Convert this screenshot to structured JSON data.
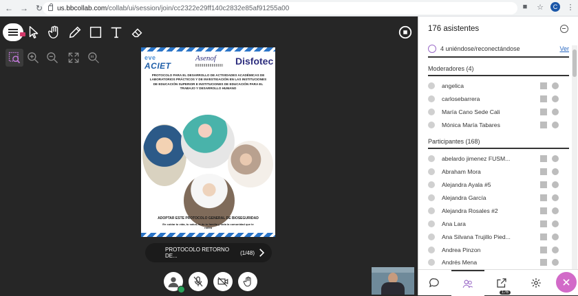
{
  "browser": {
    "url_host": "us.bbcollab.com",
    "url_path": "/collab/ui/session/join/cc2322e29ff140c2832e85af91255a00",
    "avatar_letter": "C"
  },
  "document": {
    "logo_left": "ACIET",
    "logo_left_top": "eve",
    "logo_middle": "Asenof",
    "logo_right": "Disfotec",
    "title": "PROTOCOLO PARA EL DESARROLLO DE ACTIVIDADES ACADÉMICAS DE LABORATORIOS PRÁCTICOS Y DE INVESTIGACIÓN EN LAS INSTITUCIONES DE EDUCACIÓN SUPERIOR E INSTITUCIONES DE EDUCACIÓN PARA EL TRABAJO Y DESARROLLO HUMANO",
    "footer_title": "ADOPTAR ESTE PROTOCOLO GENERAL DE BIOSEGURIDAD",
    "footer_line": "En cuidar tu vida, tu salud, la de tu familia y toda la comunidad que te rodea"
  },
  "slide_nav": {
    "name": "PROTOCOLO RETORNO DE...",
    "count": "(1/48)"
  },
  "panel": {
    "title": "176 asistentes",
    "rejoin_text": "4 uniéndose/reconectándose",
    "rejoin_link": "Ver",
    "moderators_label": "Moderadores (4)",
    "moderators": [
      "angelica",
      "carlosebarrera",
      "María Cano Sede Cali",
      "Mónica María Tabares"
    ],
    "participants_label": "Participantes (168)",
    "participants": [
      "abelardo jimenez FUSM...",
      "Abraham Mora",
      "Alejandra Ayala #5",
      "Alejandra García",
      "Alejandra Rosales #2",
      "Ana Lara",
      "Ana Silvana Trujillo Pied...",
      "Andrea Pinzon",
      "Andrés Mena"
    ],
    "footer_badge": "176"
  },
  "colors": {
    "stage_bg": "#262626",
    "accent_pink": "#d26ac8",
    "link_blue": "#2766c0",
    "doc_blue": "#2a74c7"
  }
}
